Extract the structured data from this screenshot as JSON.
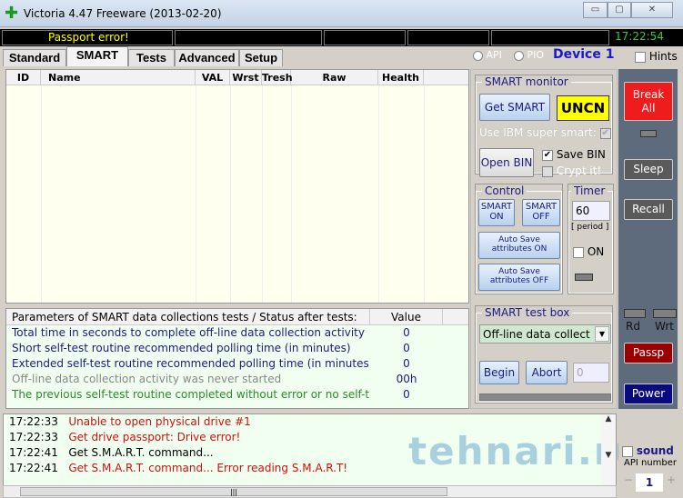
{
  "window": {
    "title": "Victoria 4.47  Freeware (2013-02-20)",
    "min": "▭",
    "max": "▢",
    "close": "✕"
  },
  "status": {
    "message": "Passport error!",
    "clock": "17:22:54"
  },
  "tabs": [
    "Standard",
    "SMART",
    "Tests",
    "Advanced",
    "Setup"
  ],
  "device": {
    "api": "API",
    "pio": "PIO",
    "label": "Device 1",
    "hints": "Hints"
  },
  "grid": {
    "columns": [
      "ID",
      "Name",
      "VAL",
      "Wrst",
      "Tresh",
      "Raw",
      "Health"
    ]
  },
  "params": {
    "header": "Parameters of SMART data collections tests / Status after tests:",
    "value_header": "Value",
    "rows": [
      {
        "label": "Total time in seconds to complete off-line data collection activity",
        "value": "0",
        "color": "#1a1a80"
      },
      {
        "label": "Short self-test routine recommended polling time (in minutes)",
        "value": "0",
        "color": "#1a1a80"
      },
      {
        "label": "Extended self-test routine recommended polling time (in minutes)",
        "value": "0",
        "color": "#1a1a80"
      },
      {
        "label": "Off-line data collection activity was never started",
        "value": "00h",
        "color": "#888888"
      },
      {
        "label": "The previous self-test routine completed without error or no self-t...",
        "value": "0",
        "color": "#2a8a2a"
      }
    ]
  },
  "log": [
    {
      "time": "17:22:33",
      "text": "Unable to open physical drive #1",
      "color": "#d01010"
    },
    {
      "time": "17:22:33",
      "text": "Get drive passport: Drive error!",
      "color": "#d01010"
    },
    {
      "time": "17:22:41",
      "text": "Get S.M.A.R.T. command...",
      "color": "#000000"
    },
    {
      "time": "17:22:41",
      "text": "Get S.M.A.R.T. command... Error reading S.M.A.R.T!",
      "color": "#d01010"
    }
  ],
  "smart_monitor": {
    "title": "SMART monitor",
    "get_smart": "Get SMART",
    "status": "UNCN",
    "ibm": "Use IBM super smart:",
    "open_bin": "Open BIN",
    "save_bin": "Save BIN",
    "crypt": "Crypt it!"
  },
  "control": {
    "title": "Control",
    "smart_on": "SMART ON",
    "smart_off": "SMART OFF",
    "autosave_on": "Auto Save attributes ON",
    "autosave_off": "Auto Save attributes OFF"
  },
  "timer": {
    "title": "Timer",
    "value": "60",
    "period": "[ period ]",
    "on": "ON"
  },
  "testbox": {
    "title": "SMART test box",
    "selected": "Off-line data collect",
    "begin": "Begin",
    "abort": "Abort",
    "count": "0"
  },
  "side": {
    "break": "Break All",
    "sleep": "Sleep",
    "recall": "Recall",
    "rd": "Rd",
    "wrt": "Wrt",
    "passp": "Passp",
    "power": "Power",
    "sound": "sound",
    "api_number": "API number",
    "api_value": "1",
    "minus": "−",
    "plus": "+"
  },
  "watermark": "tehnari.ru"
}
